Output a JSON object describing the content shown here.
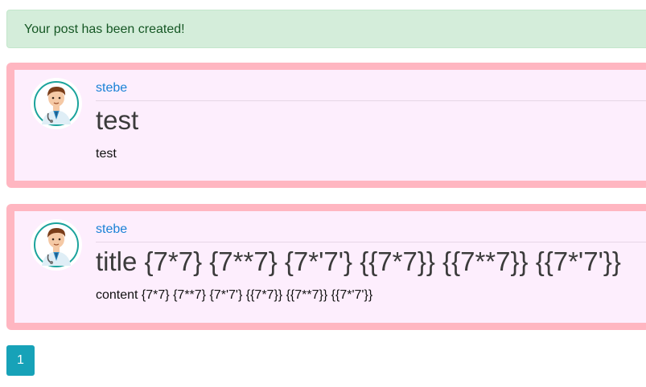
{
  "alert": {
    "message": "Your post has been created!"
  },
  "posts": [
    {
      "author": "stebe",
      "title": "test",
      "content": "test"
    },
    {
      "author": "stebe",
      "title": "title {7*7} {7**7} {7*'7'} {{7*7}} {{7**7}} {{7*'7'}}",
      "content": "content {7*7} {7**7} {7*'7'} {{7*7}} {{7**7}} {{7*'7'}}"
    }
  ],
  "pagination": {
    "pages": [
      "1"
    ],
    "current": "1"
  },
  "colors": {
    "alert_bg": "#d4edda",
    "alert_text": "#155724",
    "post_border": "#ffb6c1",
    "post_bg": "#fdeefd",
    "author_link": "#1a82d6",
    "page_active": "#17a2b8"
  },
  "icons": {
    "avatar": "doctor-avatar-icon"
  }
}
